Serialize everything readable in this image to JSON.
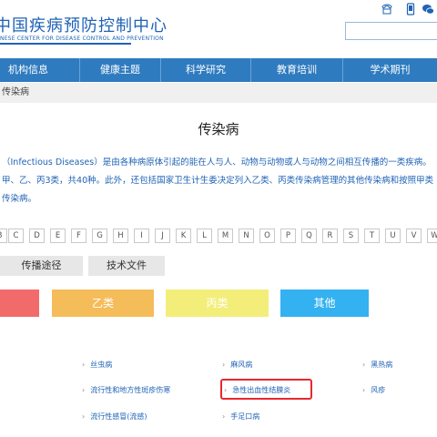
{
  "header": {
    "title": "中国疾病预防控制中心",
    "subtitle": "NESE CENTER FOR DISEASE CONTROL AND PREVENTION"
  },
  "nav": {
    "items": [
      "机构信息",
      "健康主题",
      "科学研究",
      "教育培训",
      "学术期刊"
    ]
  },
  "breadcrumb": "传染病",
  "page_title": "传染病",
  "description": [
    "（Infectious Diseases）是由各种病原体引起的能在人与人、动物与动物或人与动物之间相互传播的一类疾病。",
    "甲、乙、丙3类，共40种。此外，还包括国家卫生计生委决定列入乙类、丙类传染病管理的其他传染病和按照甲类",
    "传染病。"
  ],
  "letters": [
    "B",
    "C",
    "D",
    "E",
    "F",
    "G",
    "H",
    "I",
    "J",
    "K",
    "L",
    "M",
    "N",
    "O",
    "P",
    "Q",
    "R",
    "S",
    "T",
    "U",
    "V",
    "W"
  ],
  "tabs": [
    "传播途径",
    "技术文件"
  ],
  "categories": [
    {
      "label": "",
      "color": "#f26b6b"
    },
    {
      "label": "乙类",
      "color": "#f5bc5a"
    },
    {
      "label": "丙类",
      "color": "#f3ee7a"
    },
    {
      "label": "其他",
      "color": "#33b1f0"
    }
  ],
  "diseases": [
    "丝虫病",
    "麻风病",
    "黑热病",
    "流行性和地方性斑疹伤寒",
    "急性出血性结膜炎",
    "风疹",
    "流行性感冒(流感)",
    "手足口病"
  ],
  "colors": {
    "nav": "#2f7bbf",
    "brand": "#1f63b5",
    "highlight": "#e8282e"
  }
}
